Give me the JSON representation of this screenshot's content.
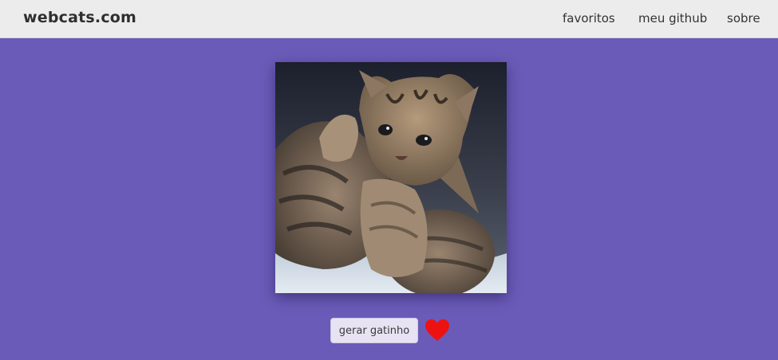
{
  "header": {
    "brand": "webcats.com",
    "nav": [
      {
        "label": "favoritos"
      },
      {
        "label": "meu github"
      },
      {
        "label": "sobre"
      }
    ]
  },
  "main": {
    "image_alt": "two tabby kittens cuddling",
    "generate_label": "gerar gatinho",
    "favorite_icon": "heart-icon"
  },
  "colors": {
    "background": "#6a5bb8",
    "header": "#ececec",
    "heart": "#ee1111"
  }
}
